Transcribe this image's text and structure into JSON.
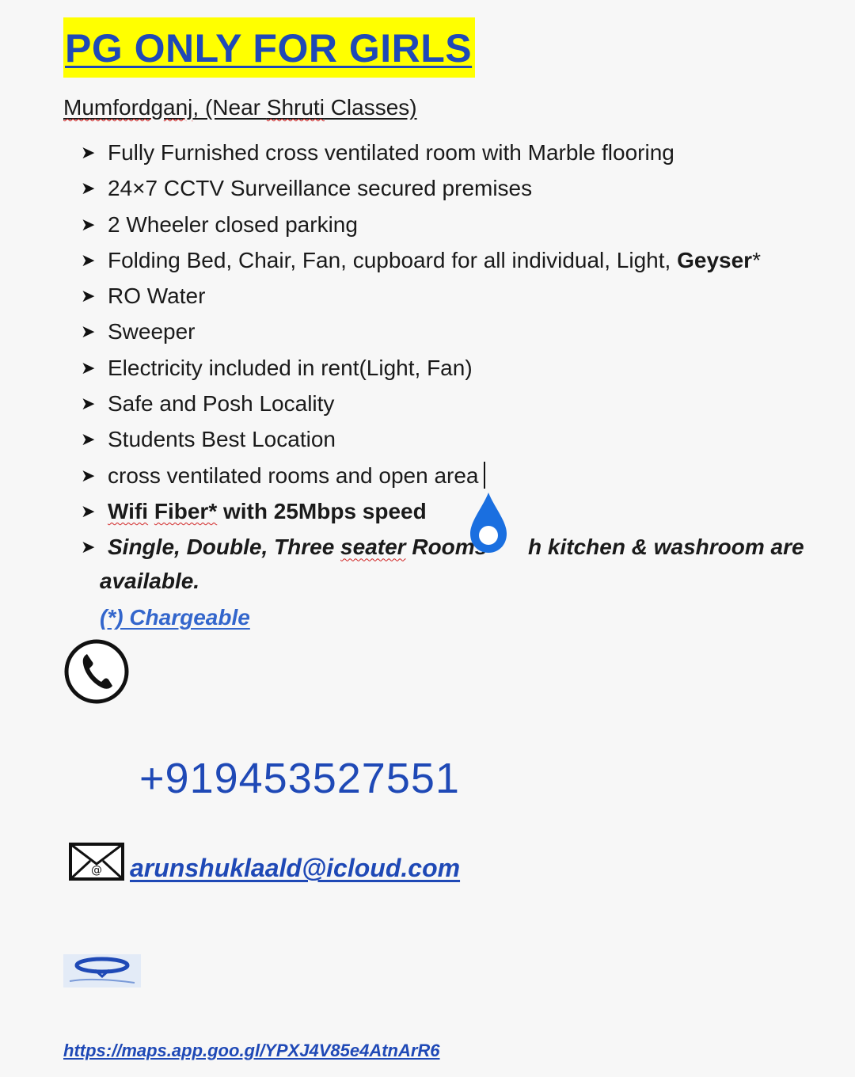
{
  "title": "PG ONLY FOR GIRLS",
  "address": {
    "place": "Mumfordganj",
    "rest": ", (Near ",
    "shruti": "Shruti",
    "classes": " Classes)"
  },
  "features": [
    {
      "text": "Fully Furnished cross ventilated room with Marble flooring"
    },
    {
      "text": "24×7 CCTV Surveillance secured premises"
    },
    {
      "text": "2 Wheeler closed parking"
    },
    {
      "text": "Folding Bed, Chair, Fan, cupboard for all individual, Light, ",
      "bold": "Geyser",
      "suffix": "*"
    },
    {
      "text": "RO Water"
    },
    {
      "text": "Sweeper"
    },
    {
      "text": "Electricity included in rent(Light, Fan)"
    },
    {
      "text": "Safe and Posh Locality"
    },
    {
      "text": "Students Best Location"
    },
    {
      "text": "cross ventilated rooms and open area"
    },
    {
      "a": "Wifi",
      "b": "Fiber*",
      "c": " with 25Mbps speed"
    },
    {
      "a": "Single, Double, Three ",
      "b": "seater",
      "c": " Rooms ",
      "d": "h kitchen & washroom  are"
    }
  ],
  "available": "available.",
  "chargeable": "(*) Chargeable",
  "phone": "+919453527551",
  "email": "arunshuklaald@icloud.com",
  "map_link": "https://maps.app.goo.gl/YPXJ4V85e4AtnArR6",
  "colors": {
    "title_bg": "#ffff00",
    "title_text": "#1f49b6",
    "link": "#1f49b6",
    "drop": "#1a6fe0"
  },
  "icons": [
    "phone-icon",
    "mail-icon",
    "water-drop-icon",
    "maps-icon"
  ]
}
